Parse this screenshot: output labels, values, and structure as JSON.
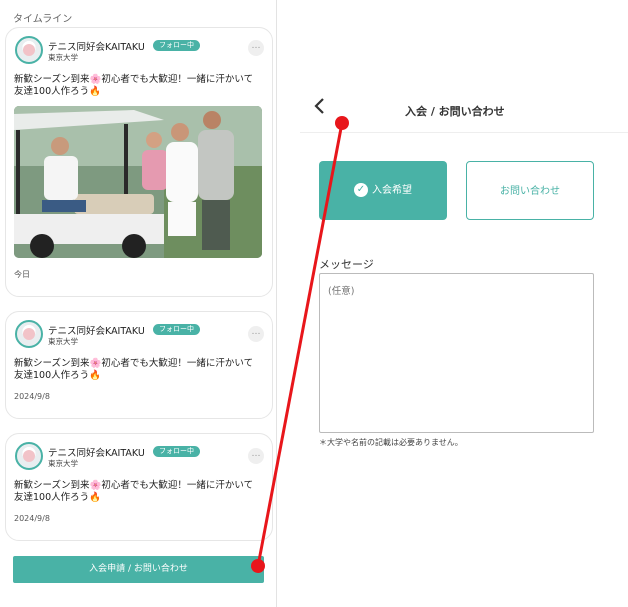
{
  "timeline": {
    "title": "タイムライン",
    "posts": [
      {
        "club": "テニス同好会KAITAKU",
        "follow_badge": "フォロー中",
        "university": "東京大学",
        "more": "…",
        "text_line1": "新歓シーズン到来🌸初心者でも大歓迎！一緒に汗かいて",
        "text_line2": "友達100人作ろう🔥",
        "date": "今日"
      },
      {
        "club": "テニス同好会KAITAKU",
        "follow_badge": "フォロー中",
        "university": "東京大学",
        "more": "…",
        "text_line1": "新歓シーズン到来🌸初心者でも大歓迎！一緒に汗かいて",
        "text_line2": "友達100人作ろう🔥",
        "date": "2024/9/8"
      },
      {
        "club": "テニス同好会KAITAKU",
        "follow_badge": "フォロー中",
        "university": "東京大学",
        "more": "…",
        "text_line1": "新歓シーズン到来🌸初心者でも大歓迎！一緒に汗かいて",
        "text_line2": "友達100人作ろう🔥",
        "date": "2024/9/8"
      }
    ],
    "apply_button": "入会申請 / お問い合わせ"
  },
  "modal": {
    "back_icon": "chevron-left-icon",
    "title": "入会 / お問い合わせ",
    "options": [
      {
        "label": "入会希望",
        "selected": true,
        "icon": "check-circle-icon"
      },
      {
        "label": "お問い合わせ",
        "selected": false
      }
    ],
    "message_label": "メッセージ",
    "message_placeholder": "(任意)",
    "note": "＊大学や名前の記載は必要ありません。"
  },
  "colors": {
    "accent": "#49b2a6",
    "annotation": "#e8161b"
  }
}
